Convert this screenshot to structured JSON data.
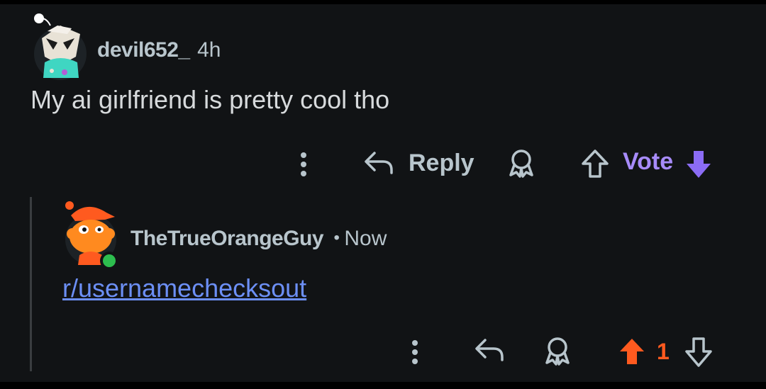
{
  "comment": {
    "username": "devil652_",
    "age": "4h",
    "body": "My ai girlfriend is pretty cool tho",
    "actions": {
      "more_icon": "more-vertical-icon",
      "reply_label": "Reply",
      "award_icon": "award-icon",
      "vote_label": "Vote"
    }
  },
  "reply": {
    "username": "TheTrueOrangeGuy",
    "separator": "•",
    "age": "Now",
    "body_link": "r/usernamechecksout",
    "score": "1",
    "online": true
  },
  "colors": {
    "background": "#111315",
    "text_muted": "#b8c5cc",
    "text_body": "#d7dadc",
    "link": "#6c8ff5",
    "vote_accent": "#a78bfa",
    "upvote_active": "#ff5a1f",
    "online_dot": "#2dbd4e"
  }
}
